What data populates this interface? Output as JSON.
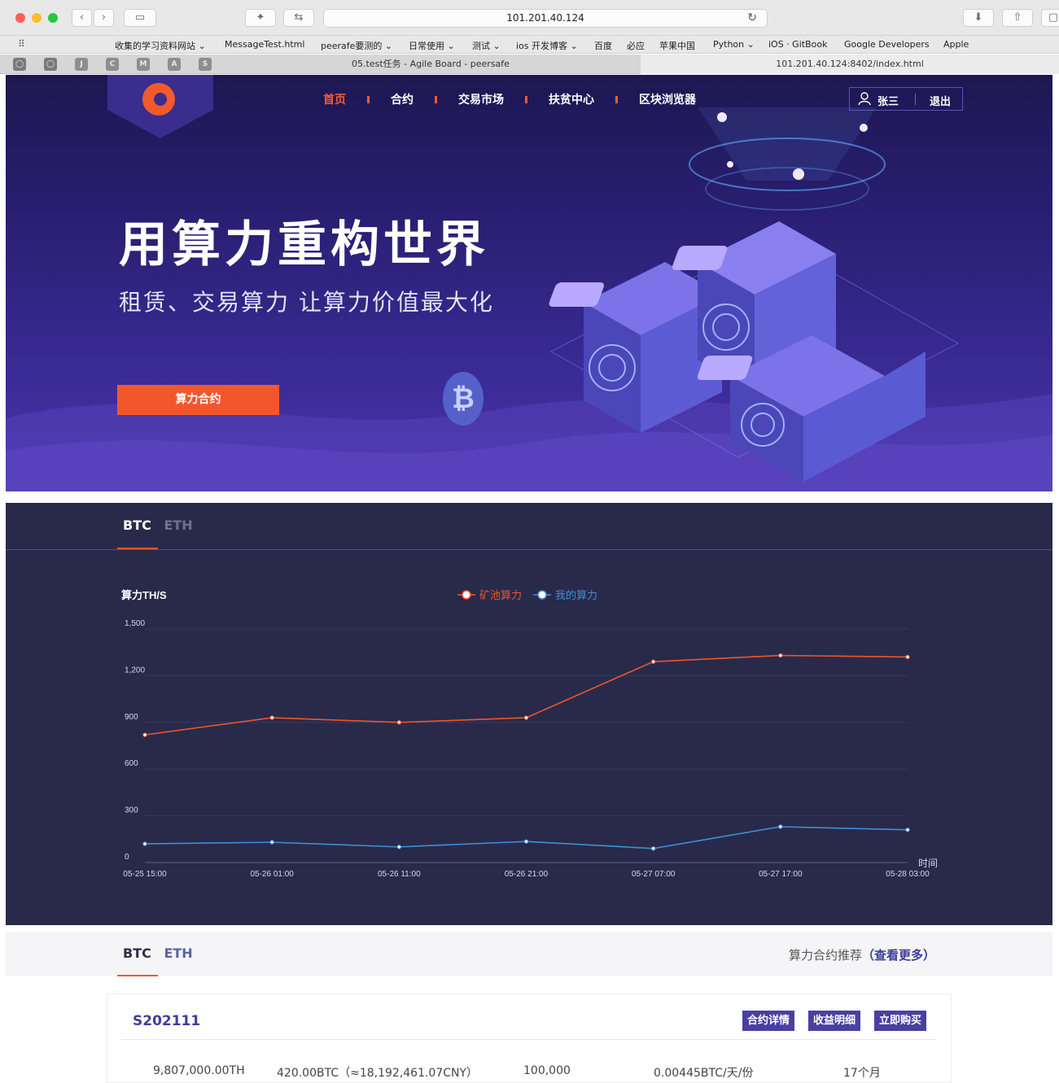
{
  "browser": {
    "url": "101.201.40.124",
    "bookmarks": [
      "收集的学习资料网站 ⌄",
      "MessageTest.html",
      "peerafe要测的 ⌄",
      "日常使用 ⌄",
      "测试 ⌄",
      "ios 开发博客 ⌄",
      "百度",
      "必应",
      "苹果中国",
      "Python ⌄",
      "iOS · GitBook",
      "Google Developers",
      "Apple"
    ],
    "pinned_tabs": [
      "J",
      "C",
      "M",
      "A",
      "S"
    ],
    "tabs": [
      "05.test任务 - Agile Board - peersafe",
      "101.201.40.124:8402/index.html"
    ]
  },
  "nav": {
    "items": [
      "首页",
      "合约",
      "交易市场",
      "扶贫中心",
      "区块浏览器"
    ],
    "active_index": 0,
    "user_name": "张三",
    "logout": "退出"
  },
  "hero": {
    "title": "用算力重构世界",
    "subtitle": "租赁、交易算力 让算力价值最大化",
    "cta": "算力合约",
    "coin_symbol": "₿"
  },
  "chart_section": {
    "tabs": [
      "BTC",
      "ETH"
    ],
    "active_tab": "BTC"
  },
  "chart_data": {
    "type": "line",
    "ylabel": "算力TH/S",
    "xlabel": "时间",
    "categories": [
      "05-25 15:00",
      "05-26 01:00",
      "05-26 11:00",
      "05-26 21:00",
      "05-27 07:00",
      "05-27 17:00",
      "05-28 03:00"
    ],
    "yticks": [
      "0",
      "300",
      "600",
      "900",
      "1,200",
      "1,500"
    ],
    "ylim": [
      0,
      1500
    ],
    "grid": true,
    "legend_position": "top-center",
    "series": [
      {
        "name": "矿池算力",
        "color": "#f0542a",
        "values": [
          820,
          930,
          900,
          930,
          1290,
          1330,
          1320
        ]
      },
      {
        "name": "我的算力",
        "color": "#3e8fd6",
        "values": [
          120,
          130,
          100,
          135,
          90,
          230,
          210
        ]
      }
    ]
  },
  "recommend": {
    "tabs": [
      "BTC",
      "ETH"
    ],
    "title": "算力合约推荐",
    "more": "（查看更多）",
    "card": {
      "id": "S202111",
      "buttons": [
        "合约详情",
        "收益明细",
        "立即购买"
      ],
      "cells": [
        "9,807,000.00TH",
        "420.00BTC（≈18,192,461.07CNY）",
        "100,000",
        "0.00445BTC/天/份",
        "17个月"
      ]
    }
  },
  "colors": {
    "accent": "#f25a2b",
    "hero_bg": "#2a1f73",
    "chart_bg": "#292a4a",
    "brand_purple": "#4a3fa3"
  }
}
